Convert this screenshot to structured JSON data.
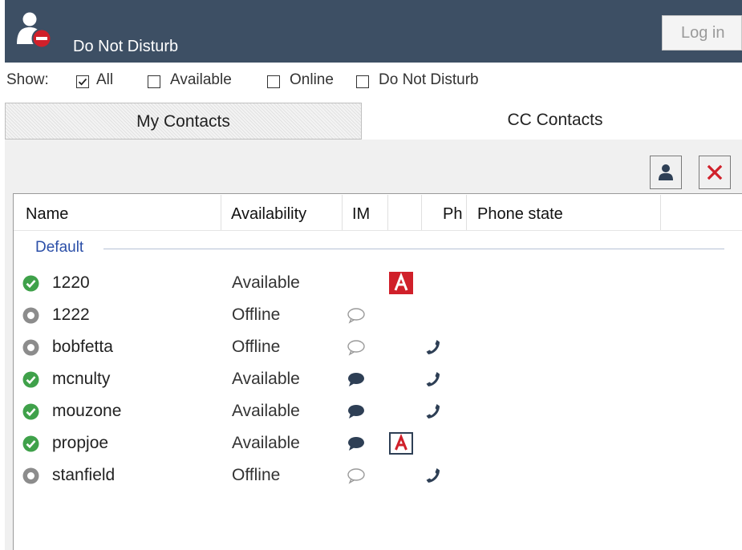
{
  "header": {
    "status_text": "Do Not Disturb",
    "login_label": "Log in",
    "avatar_icon": "user-do-not-disturb-icon",
    "background_color": "#3d4f64"
  },
  "filters": {
    "show_label": "Show:",
    "options": [
      {
        "label": "All",
        "checked": true
      },
      {
        "label": "Available",
        "checked": false
      },
      {
        "label": "Online",
        "checked": false
      },
      {
        "label": "Do Not Disturb",
        "checked": false
      }
    ]
  },
  "tabs": [
    {
      "label": "My Contacts",
      "active": false
    },
    {
      "label": "CC Contacts",
      "active": true
    }
  ],
  "toolbar": {
    "add_icon": "person-icon",
    "remove_icon": "close-icon"
  },
  "columns": [
    "Name",
    "Availability",
    "IM",
    "",
    "Ph",
    "Phone state"
  ],
  "group": {
    "label": "Default"
  },
  "contacts": [
    {
      "name": "1220",
      "availability": "Available",
      "status": "online",
      "im": "none",
      "agent_badge": "filled",
      "phone": false
    },
    {
      "name": "1222",
      "availability": "Offline",
      "status": "offline",
      "im": "outline",
      "agent_badge": "none",
      "phone": false
    },
    {
      "name": "bobfetta",
      "availability": "Offline",
      "status": "offline",
      "im": "outline",
      "agent_badge": "none",
      "phone": true
    },
    {
      "name": "mcnulty",
      "availability": "Available",
      "status": "online",
      "im": "filled",
      "agent_badge": "none",
      "phone": true
    },
    {
      "name": "mouzone",
      "availability": "Available",
      "status": "online",
      "im": "filled",
      "agent_badge": "none",
      "phone": true
    },
    {
      "name": "propjoe",
      "availability": "Available",
      "status": "online",
      "im": "filled",
      "agent_badge": "outlined",
      "phone": false
    },
    {
      "name": "stanfield",
      "availability": "Offline",
      "status": "offline",
      "im": "outline",
      "agent_badge": "none",
      "phone": true
    }
  ],
  "colors": {
    "online": "#3fa14a",
    "offline": "#8c8c8c",
    "accent_red": "#d0202a",
    "group_label": "#2b4fa8"
  }
}
